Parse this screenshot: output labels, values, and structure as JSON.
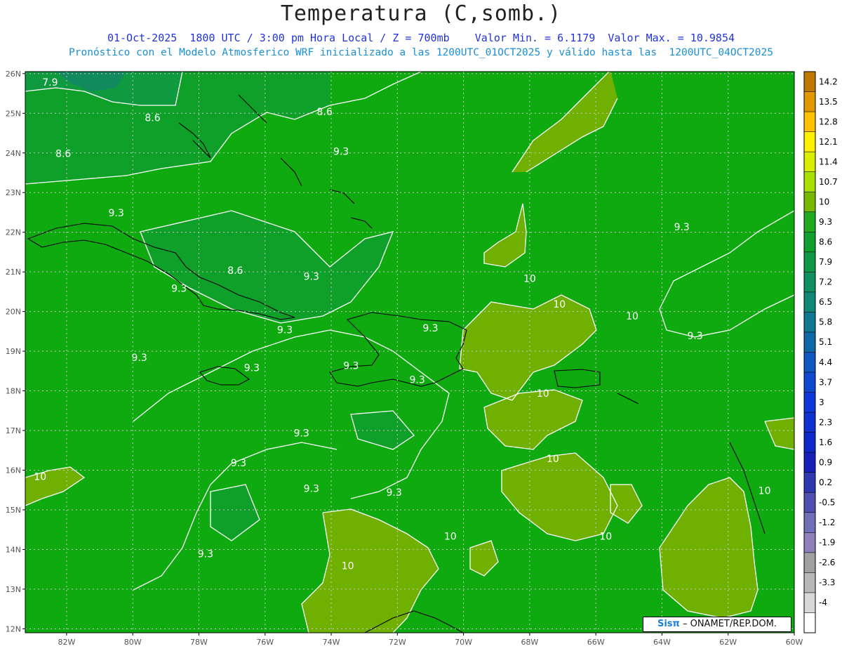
{
  "header": {
    "title": "Temperatura (C,somb.)",
    "line1": "01-Oct-2025  1800 UTC / 3:00 pm Hora Local / Z = 700mb    Valor Min. = 6.1179  Valor Max. = 10.9854",
    "line2": "Pronóstico con el Modelo Atmosferico WRF inicializado a las 1200UTC_01OCT2025 y válido hasta las  1200UTC_04OCT2025"
  },
  "axes": {
    "lat_labels": [
      "26N",
      "25N",
      "24N",
      "23N",
      "22N",
      "21N",
      "20N",
      "19N",
      "18N",
      "17N",
      "16N",
      "15N",
      "14N",
      "13N",
      "12N"
    ],
    "lon_labels": [
      "82W",
      "80W",
      "78W",
      "76W",
      "74W",
      "72W",
      "70W",
      "68W",
      "66W",
      "64W",
      "62W",
      "60W"
    ]
  },
  "colorbar": {
    "labels": [
      "14.2",
      "13.5",
      "12.8",
      "12.1",
      "11.4",
      "10.7",
      "10",
      "9.3",
      "8.6",
      "7.9",
      "7.2",
      "6.5",
      "5.8",
      "5.1",
      "4.4",
      "3.7",
      "3",
      "2.3",
      "1.6",
      "0.9",
      "0.2",
      "-0.5",
      "-1.2",
      "-1.9",
      "-2.6",
      "-3.3",
      "-4"
    ],
    "colors": [
      "#c07800",
      "#e09a00",
      "#ffc000",
      "#fff000",
      "#d8f000",
      "#a8e000",
      "#78b800",
      "#20ab20",
      "#10a030",
      "#109848",
      "#109060",
      "#108878",
      "#107890",
      "#0f68a8",
      "#1058c0",
      "#1048d0",
      "#1038d8",
      "#1030d0",
      "#1028c8",
      "#1820b8",
      "#3038b0",
      "#5050b0",
      "#7070b8",
      "#9080b8",
      "#a0a0a0",
      "#b8b8b8",
      "#d8d8d8",
      "#ffffff"
    ]
  },
  "contour_labels": [
    {
      "text": "7.9",
      "lon": -82.5,
      "lat": 25.7
    },
    {
      "text": "8.6",
      "lon": -79.4,
      "lat": 24.8
    },
    {
      "text": "8.6",
      "lon": -82.1,
      "lat": 23.9
    },
    {
      "text": "8.6",
      "lon": -74.2,
      "lat": 24.95
    },
    {
      "text": "9.3",
      "lon": -73.7,
      "lat": 23.95
    },
    {
      "text": "9.3",
      "lon": -80.5,
      "lat": 22.4
    },
    {
      "text": "9.3",
      "lon": -63.4,
      "lat": 22.05
    },
    {
      "text": "8.6",
      "lon": -76.9,
      "lat": 20.95
    },
    {
      "text": "9.3",
      "lon": -78.6,
      "lat": 20.5
    },
    {
      "text": "9.3",
      "lon": -74.6,
      "lat": 20.8
    },
    {
      "text": "10",
      "lon": -68.0,
      "lat": 20.75
    },
    {
      "text": "10",
      "lon": -67.1,
      "lat": 20.1
    },
    {
      "text": "10",
      "lon": -64.9,
      "lat": 19.8
    },
    {
      "text": "9.3",
      "lon": -75.4,
      "lat": 19.45
    },
    {
      "text": "9.3",
      "lon": -71.0,
      "lat": 19.5
    },
    {
      "text": "9.3",
      "lon": -63.0,
      "lat": 19.3
    },
    {
      "text": "9.3",
      "lon": -79.8,
      "lat": 18.75
    },
    {
      "text": "9.3",
      "lon": -76.4,
      "lat": 18.5
    },
    {
      "text": "9.3",
      "lon": -73.4,
      "lat": 18.55
    },
    {
      "text": "9.3",
      "lon": -71.4,
      "lat": 18.2
    },
    {
      "text": "10",
      "lon": -67.6,
      "lat": 17.85
    },
    {
      "text": "9.3",
      "lon": -74.9,
      "lat": 16.85
    },
    {
      "text": "9.3",
      "lon": -76.8,
      "lat": 16.1
    },
    {
      "text": "10",
      "lon": -67.3,
      "lat": 16.2
    },
    {
      "text": "10",
      "lon": -82.8,
      "lat": 15.75
    },
    {
      "text": "9.3",
      "lon": -74.6,
      "lat": 15.45
    },
    {
      "text": "9.3",
      "lon": -72.1,
      "lat": 15.35
    },
    {
      "text": "10",
      "lon": -60.9,
      "lat": 15.4
    },
    {
      "text": "10",
      "lon": -70.4,
      "lat": 14.25
    },
    {
      "text": "10",
      "lon": -65.7,
      "lat": 14.25
    },
    {
      "text": "9.3",
      "lon": -77.8,
      "lat": 13.8
    },
    {
      "text": "10",
      "lon": -73.5,
      "lat": 13.5
    }
  ],
  "credit": {
    "brand": "Sisπ",
    "text": "– ONAMET/REP.DOM."
  }
}
